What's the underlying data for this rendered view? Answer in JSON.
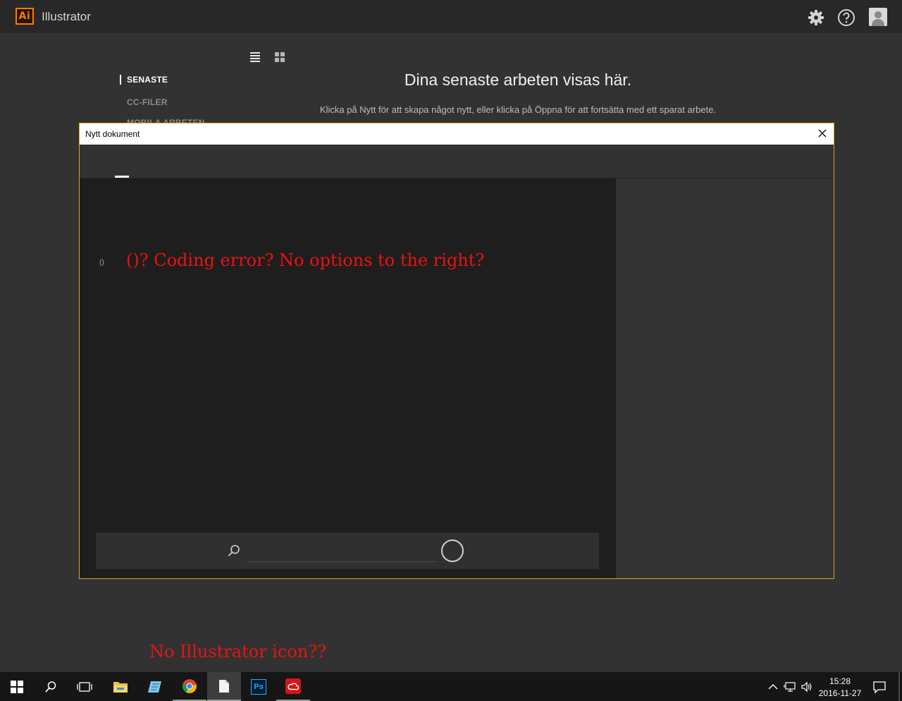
{
  "app": {
    "logo_text": "Ai",
    "title": "Illustrator",
    "icons": [
      "gear-icon",
      "help-icon",
      "user-avatar-icon"
    ]
  },
  "home": {
    "nav": {
      "recent": "SENASTE",
      "cc_files": "CC-FILER",
      "mobile": "MOBILA ARBETEN"
    },
    "heading": "Dina senaste arbeten visas här.",
    "subheading": "Klicka på Nytt för att skapa något nytt, eller klicka på Öppna för att fortsätta med ett sparat arbete."
  },
  "dialog": {
    "title": "Nytt dokument",
    "placeholder_text": "()",
    "search": {
      "value": "",
      "placeholder": ""
    }
  },
  "annotations": {
    "note_1": "()? Coding error? No options to the right?",
    "note_2": "No Illustrator icon??"
  },
  "taskbar": {
    "ps_label": "Ps",
    "time": "15:28",
    "date": "2016-11-27"
  },
  "colors": {
    "illustrator_orange": "#FF7C00",
    "annotation_red": "#EE1111",
    "dialog_border": "#E0A030",
    "photoshop_blue": "#31A8FF",
    "creative_cloud_red": "#D4141B"
  }
}
